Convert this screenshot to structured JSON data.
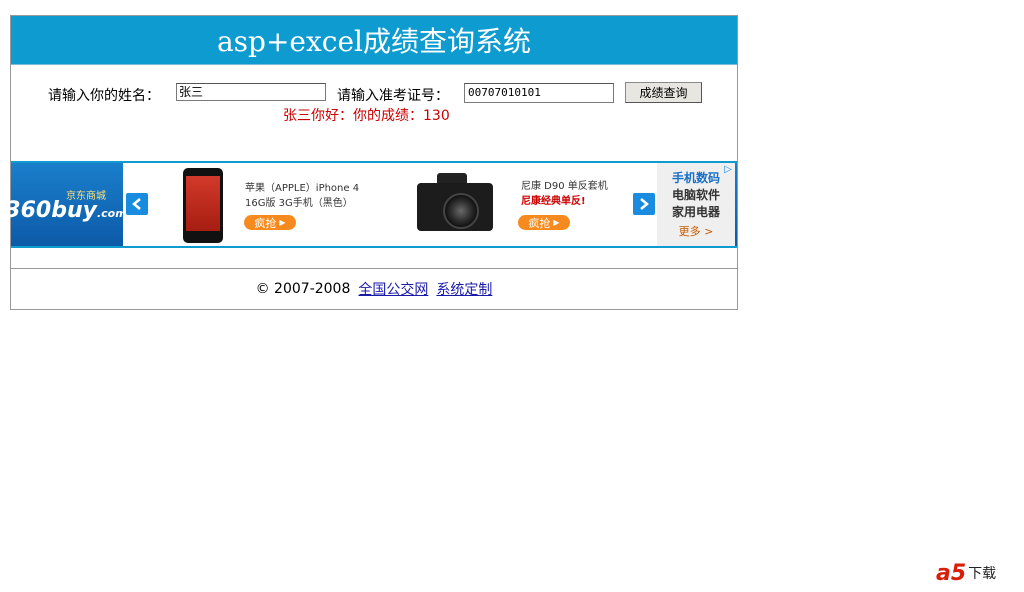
{
  "header": {
    "title": "asp+excel成绩查询系统"
  },
  "form": {
    "name_label": "请输入你的姓名：",
    "name_value": "张三",
    "exam_label": "请输入准考证号：",
    "exam_value": "00707010101",
    "search_button": "成绩查询"
  },
  "result": {
    "text": "张三你好：你的成绩：130",
    "color": "#cc0000"
  },
  "ad": {
    "logo_sub": "京东商城",
    "logo_brand": "360buy",
    "logo_suffix": ".com",
    "left_arrow_icon": "chevron-left-icon",
    "right_arrow_icon": "chevron-right-icon",
    "product1_line1": "苹果（APPLE）iPhone 4",
    "product1_line2": "16G版 3G手机（黑色）",
    "product1_button": "疯抢",
    "product2_line1": "尼康 D90 单反套机",
    "product2_line2": "尼康经典单反!",
    "product2_button": "疯抢",
    "side_hot": "手机数码",
    "side_item1": "电脑软件",
    "side_item2": "家用电器",
    "side_more": "更多 >",
    "ad_mark": "▷"
  },
  "footer": {
    "copyright": "© 2007-2008",
    "link1": "全国公交网",
    "link2": "系统定制"
  },
  "watermark": {
    "logo": "a5",
    "text": "下载"
  },
  "colors": {
    "header_bg": "#0e9bd0",
    "result_text": "#cc0000",
    "link": "#1a1aa8"
  }
}
